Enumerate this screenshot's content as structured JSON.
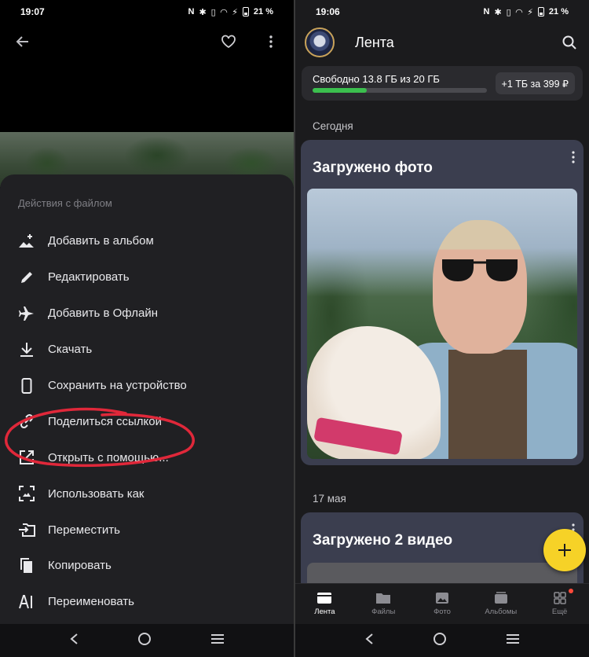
{
  "left": {
    "status_time": "19:07",
    "battery": "21 %",
    "sheet_title": "Действия с файлом",
    "menu_items": [
      {
        "label": "Добавить в альбом",
        "icon": "add-to-album-icon"
      },
      {
        "label": "Редактировать",
        "icon": "pencil-icon"
      },
      {
        "label": "Добавить в Офлайн",
        "icon": "airplane-icon"
      },
      {
        "label": "Скачать",
        "icon": "download-icon"
      },
      {
        "label": "Сохранить на устройство",
        "icon": "phone-icon"
      },
      {
        "label": "Поделиться ссылкой",
        "icon": "link-icon"
      },
      {
        "label": "Открыть с помощью...",
        "icon": "open-external-icon"
      },
      {
        "label": "Использовать как",
        "icon": "use-as-icon"
      },
      {
        "label": "Переместить",
        "icon": "move-icon"
      },
      {
        "label": "Копировать",
        "icon": "copy-icon"
      },
      {
        "label": "Переименовать",
        "icon": "rename-icon"
      }
    ],
    "highlight_color": "#e0283a"
  },
  "right": {
    "status_time": "19:06",
    "battery": "21 %",
    "title": "Лента",
    "storage": {
      "text": "Свободно 13.8 ГБ из 20 ГБ",
      "used_fraction": 0.31,
      "upgrade": "+1 ТБ за 399 ₽"
    },
    "sections": [
      {
        "date": "Сегодня",
        "card_title": "Загружено фото"
      },
      {
        "date": "17 мая",
        "card_title": "Загружено 2 видео"
      }
    ],
    "tabs": [
      {
        "label": "Лента",
        "active": true
      },
      {
        "label": "Файлы",
        "active": false
      },
      {
        "label": "Фото",
        "active": false
      },
      {
        "label": "Альбомы",
        "active": false
      },
      {
        "label": "Ещё",
        "active": false
      }
    ],
    "accent": "#f6d227",
    "storage_bar_color": "#3bbf4e"
  }
}
